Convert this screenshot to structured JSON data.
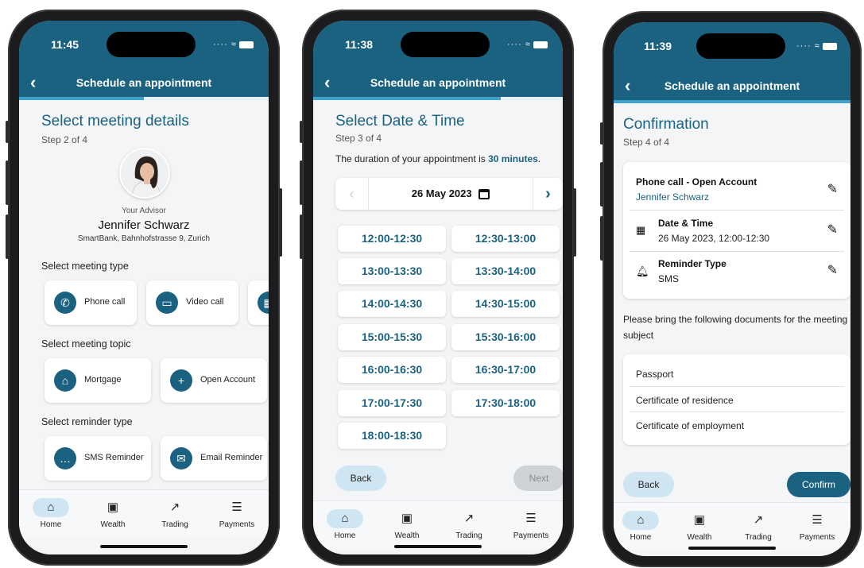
{
  "app_title": "Schedule an appointment",
  "colors": {
    "primary": "#1a6280",
    "accent": "#3fa2cb",
    "active_nav": "#cfe6f2"
  },
  "nav": [
    {
      "label": "Home",
      "icon": "home-icon"
    },
    {
      "label": "Wealth",
      "icon": "wallet-icon"
    },
    {
      "label": "Trading",
      "icon": "chart-icon"
    },
    {
      "label": "Payments",
      "icon": "payments-icon"
    }
  ],
  "phone1": {
    "time": "11:45",
    "progress": 0.5,
    "heading": "Select meeting details",
    "step": "Step 2 of 4",
    "advisor_caption": "Your Advisor",
    "advisor_name": "Jennifer Schwarz",
    "advisor_address": "SmartBank, Bahnhofstrasse 9, Zurich",
    "meeting_type_label": "Select meeting type",
    "meeting_types": [
      "Phone call",
      "Video call"
    ],
    "topic_label": "Select meeting topic",
    "topics": [
      "Mortgage",
      "Open Account"
    ],
    "reminder_label": "Select reminder type",
    "reminders": [
      "SMS Reminder",
      "Email Reminder"
    ]
  },
  "phone2": {
    "time": "11:38",
    "progress": 0.75,
    "heading": "Select Date & Time",
    "step": "Step 3 of 4",
    "duration_prefix": "The duration of your appointment is ",
    "duration_value": "30 minutes",
    "duration_suffix": ".",
    "date": "26 May 2023",
    "slots": [
      "12:00-12:30",
      "12:30-13:00",
      "13:00-13:30",
      "13:30-14:00",
      "14:00-14:30",
      "14:30-15:00",
      "15:00-15:30",
      "15:30-16:00",
      "16:00-16:30",
      "16:30-17:00",
      "17:00-17:30",
      "17:30-18:00",
      "18:00-18:30"
    ],
    "back": "Back",
    "next": "Next"
  },
  "phone3": {
    "time": "11:39",
    "progress": 1.0,
    "heading": "Confirmation",
    "step": "Step 4 of 4",
    "summary_title": "Phone call - Open Account",
    "summary_advisor": "Jennifer Schwarz",
    "datetime_label": "Date & Time",
    "datetime_value": "26 May 2023, 12:00-12:30",
    "reminder_label": "Reminder Type",
    "reminder_value": "SMS",
    "documents_intro": "Please bring the following documents for the meeting subject",
    "documents": [
      "Passport",
      "Certificate of residence",
      "Certificate of employment"
    ],
    "back": "Back",
    "confirm": "Confirm"
  }
}
